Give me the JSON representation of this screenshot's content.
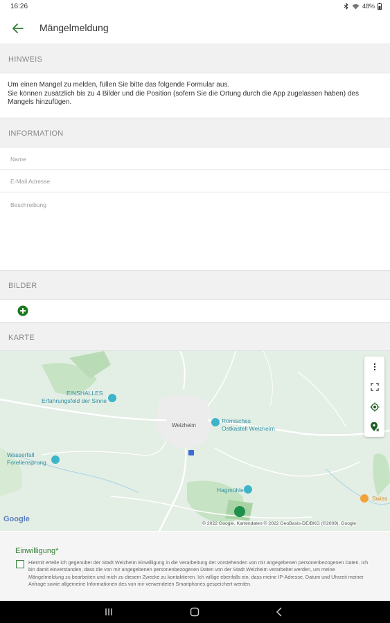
{
  "status_bar": {
    "time": "16:26",
    "battery": "48%"
  },
  "app_bar": {
    "title": "Mängelmeldung"
  },
  "sections": {
    "hint_header": "HINWEIS",
    "hint_text": "Um einen Mangel zu melden, füllen Sie bitte das folgende Formular aus.\nSie können zusätzlich bis zu 4 Bilder und die Position (sofern Sie die Ortung durch die App zugelassen haben) des Mangels hinzufügen.",
    "information_header": "INFORMATION",
    "images_header": "BILDER",
    "map_header": "KARTE"
  },
  "form": {
    "name_placeholder": "Name",
    "email_placeholder": "E-Mail Adresse",
    "description_placeholder": "Beschreibung"
  },
  "map": {
    "labels": {
      "einshalles": "EINSHALLES",
      "einshalles_sub": "Erfahrungsfeld der Sinne",
      "welzheim": "Welzheim",
      "kastell_1": "Römisches",
      "kastell_2": "Ostkastell Welzheim",
      "wasserfall_1": "Wasserfall",
      "wasserfall_2": "Forellensprung",
      "hagmuhle": "Hagmühle",
      "right_place": "Swiss"
    },
    "google_logo": "Google",
    "attribution": "© 2022 Google, Kartendaten © 2022 GeoBasis-DE/BKG (©2009), Google"
  },
  "consent": {
    "title": "Einwilligung*",
    "text": "Hiermit erteile ich gegenüber der Stadt Welzheim Einwilligung in die Verarbeitung der vorstehenden von mir angegebenen personenbezogenen Daten. Ich bin damit einverstanden, dass die von mir angegebenen personenbezogenen Daten von der Stadt Welzheim verarbeitet werden, um meine Mängelmeldung zu bearbeiten und mich zu diesem Zwecke zu kontaktieren. Ich willige ebenfalls ein, dass meine IP-Adresse, Datum und Uhrzeit meiner Anfrage sowie allgemeine Informationen des von mir verwendeten Smartphones gespeichert werden."
  },
  "colors": {
    "accent": "#2e7d32",
    "section_bg": "#f1f1f1",
    "map_bg": "#e3eee5"
  }
}
